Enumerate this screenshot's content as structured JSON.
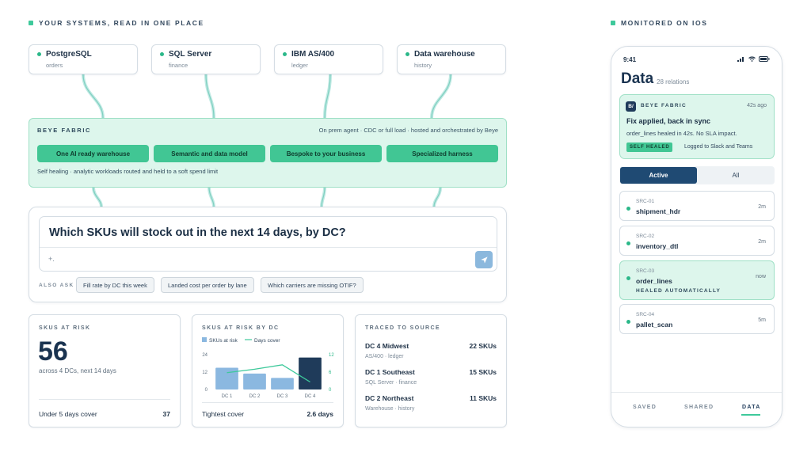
{
  "left_header": "YOUR SYSTEMS, READ IN ONE PLACE",
  "right_header": "MONITORED ON IOS",
  "sources": [
    {
      "name": "PostgreSQL",
      "sub": "orders"
    },
    {
      "name": "SQL Server",
      "sub": "finance"
    },
    {
      "name": "IBM AS/400",
      "sub": "ledger"
    },
    {
      "name": "Data warehouse",
      "sub": "history"
    }
  ],
  "fabric": {
    "title": "BEYE FABRIC",
    "desc": "On prem agent · CDC or full load · hosted and orchestrated by Beye",
    "pills": [
      "One AI ready warehouse",
      "Semantic and data model",
      "Bespoke to your business",
      "Specialized harness"
    ],
    "footer": "Self healing · analytic workloads routed and held to a soft spend limit"
  },
  "query": {
    "question": "Which SKUs will stock out in the next 14 days, by DC?",
    "plus": "+.",
    "also_ask": "ALSO ASK",
    "suggestions": [
      "Fill rate by DC this week",
      "Landed cost per order by lane",
      "Which carriers are missing OTIF?"
    ]
  },
  "risk_card": {
    "title": "SKUS AT RISK",
    "value": "56",
    "sub": "across 4 DCs, next 14 days",
    "footer_label": "Under 5 days cover",
    "footer_value": "37"
  },
  "chart_card": {
    "title": "SKUS AT RISK BY DC",
    "footer_label": "Tightest cover",
    "footer_value": "2.6 days"
  },
  "chart_data": {
    "type": "bar",
    "categories": [
      "DC 1",
      "DC 2",
      "DC 3",
      "DC 4"
    ],
    "series": [
      {
        "name": "SKUs at risk",
        "type": "bar",
        "axis": "left",
        "values": [
          15,
          11,
          8,
          22
        ]
      },
      {
        "name": "Days cover",
        "type": "line",
        "axis": "right",
        "values": [
          5.8,
          7,
          8.5,
          2.6
        ]
      }
    ],
    "y_left": {
      "ticks": [
        "24",
        "12",
        "0"
      ],
      "range": [
        0,
        24
      ]
    },
    "y_right": {
      "ticks": [
        "12",
        "6",
        "0"
      ],
      "range": [
        0,
        12
      ]
    },
    "highlight": "DC 4",
    "legend_position": "top-left",
    "grid": false,
    "colors": {
      "bar": "#8bb8e0",
      "bar_highlight": "#1f3b5a",
      "line": "#3ec99b"
    }
  },
  "trace_card": {
    "title": "TRACED TO SOURCE",
    "rows": [
      {
        "name": "DC 4 Midwest",
        "source": "AS/400 · ledger",
        "count": "22 SKUs"
      },
      {
        "name": "DC 1 Southeast",
        "source": "SQL Server · finance",
        "count": "15 SKUs"
      },
      {
        "name": "DC 2 Northeast",
        "source": "Warehouse · history",
        "count": "11 SKUs"
      }
    ]
  },
  "phone": {
    "time": "9:41",
    "title": "Data",
    "subtitle": "28 relations",
    "alert": {
      "logo": "B/",
      "name": "BEYE FABRIC",
      "time": "42s ago",
      "heading": "Fix applied, back in sync",
      "body": "order_lines healed in 42s. No SLA impact.",
      "badge": "SELF HEALED",
      "logged": "Logged to Slack and Teams"
    },
    "segments": [
      "Active",
      "All"
    ],
    "items": [
      {
        "code": "SRC-01",
        "name": "shipment_hdr",
        "time": "2m"
      },
      {
        "code": "SRC-02",
        "name": "inventory_dtl",
        "time": "2m"
      },
      {
        "code": "SRC-03",
        "name": "order_lines",
        "time": "now",
        "healed": "HEALED AUTOMATICALLY"
      },
      {
        "code": "SRC-04",
        "name": "pallet_scan",
        "time": "5m"
      }
    ],
    "tabs": [
      "SAVED",
      "SHARED",
      "DATA"
    ],
    "active_tab": "DATA"
  }
}
